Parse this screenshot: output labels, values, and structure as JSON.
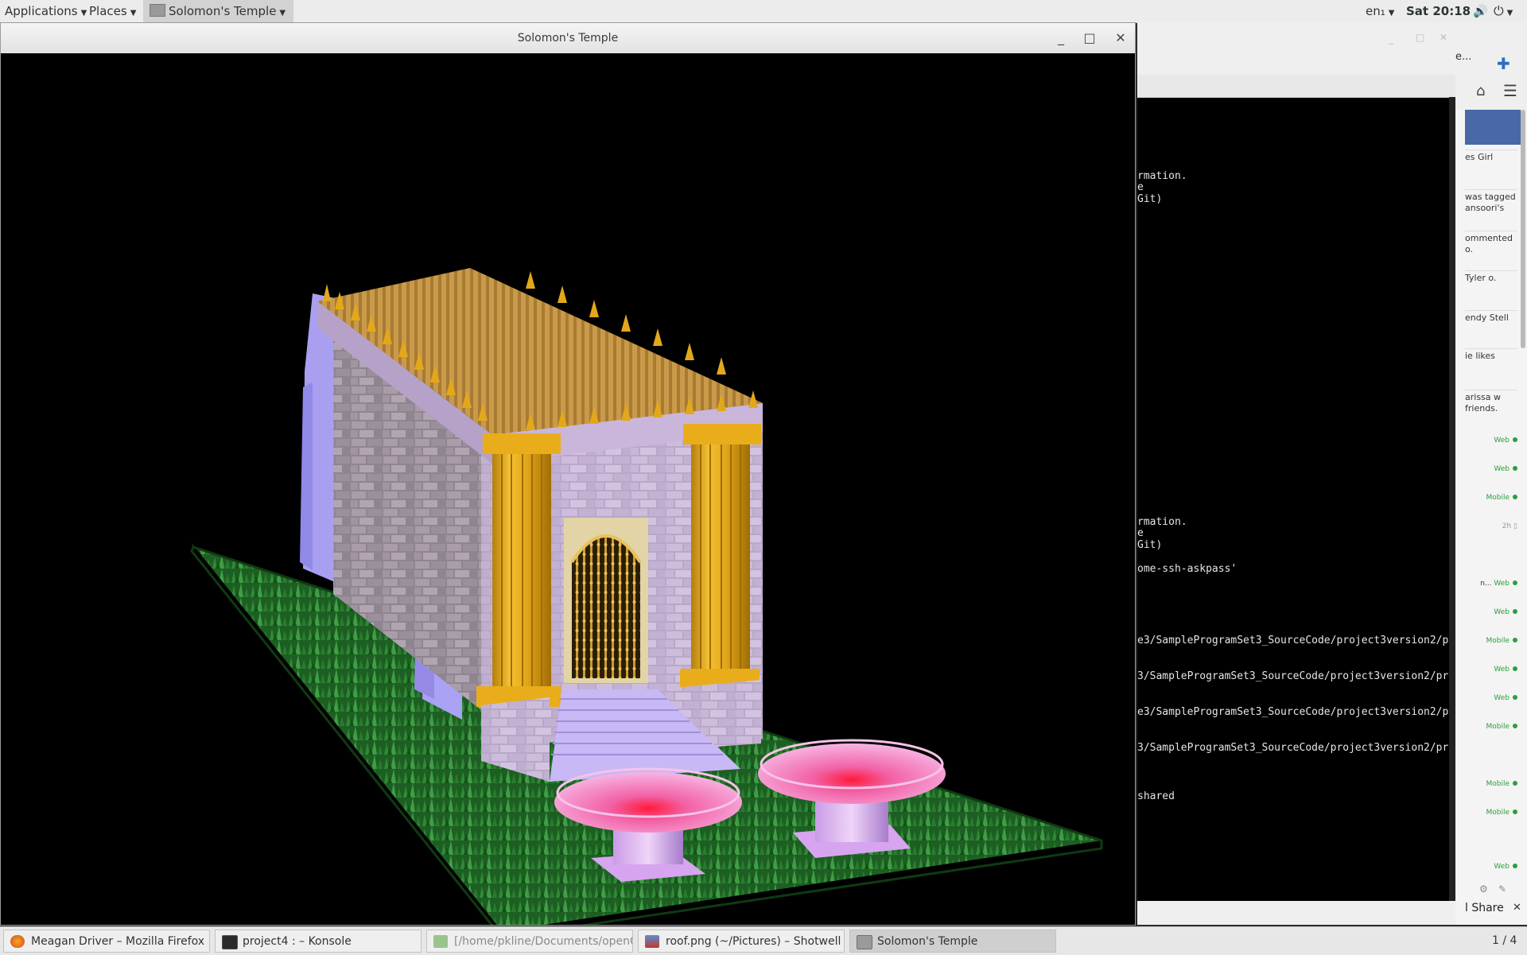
{
  "top_panel": {
    "applications": "Applications",
    "places": "Places",
    "app_menu": "Solomon's Temple",
    "keyboard_layout": "en₁",
    "clock": "Sat 20:18"
  },
  "main_window": {
    "title": "Solomon's Temple",
    "minimize": "_",
    "maximize": "□",
    "close": "✕"
  },
  "terminal": {
    "lines": [
      "rmation.",
      "e",
      " Git)",
      "rmation.",
      "e",
      " Git)",
      "ome-ssh-askpass'",
      "e3/SampleProgramSet3_SourceCode/project3version2/p",
      "3/SampleProgramSet3_SourceCode/project3version2/pr",
      "e3/SampleProgramSet3_SourceCode/project3version2/p",
      "3/SampleProgramSet3_SourceCode/project3version2/pr",
      "shared"
    ]
  },
  "firefox_sidebar": {
    "tab_label": "e...",
    "notifications": [
      "es Girl",
      "was tagged ansoori's",
      "ommented o.",
      " Tyler o.",
      "endy Stell",
      "ie likes",
      "arissa w friends."
    ],
    "chat_statuses": [
      "Web",
      "Web",
      "Mobile",
      "2h",
      "n...",
      "Web",
      "Web",
      "Mobile",
      "Web",
      "Web",
      "Mobile",
      "Mobile",
      "Mobile",
      "Web"
    ],
    "share": "l Share"
  },
  "taskbar": {
    "items": [
      {
        "label": "Meagan Driver – Mozilla Firefox"
      },
      {
        "label": "project4 : – Konsole"
      },
      {
        "label": "[/home/pkline/Documents/openGL..."
      },
      {
        "label": "roof.png (~/Pictures) – Shotwell"
      },
      {
        "label": "Solomon's Temple"
      }
    ],
    "pager": "1 / 4"
  },
  "colors": {
    "grass": "#1f6b26",
    "stone": "#c6b2d8",
    "gold": "#e3a81a",
    "roof": "#c08a3a",
    "basin_pink": "#f08fd0",
    "wall_blue": "#a9a2f2"
  }
}
